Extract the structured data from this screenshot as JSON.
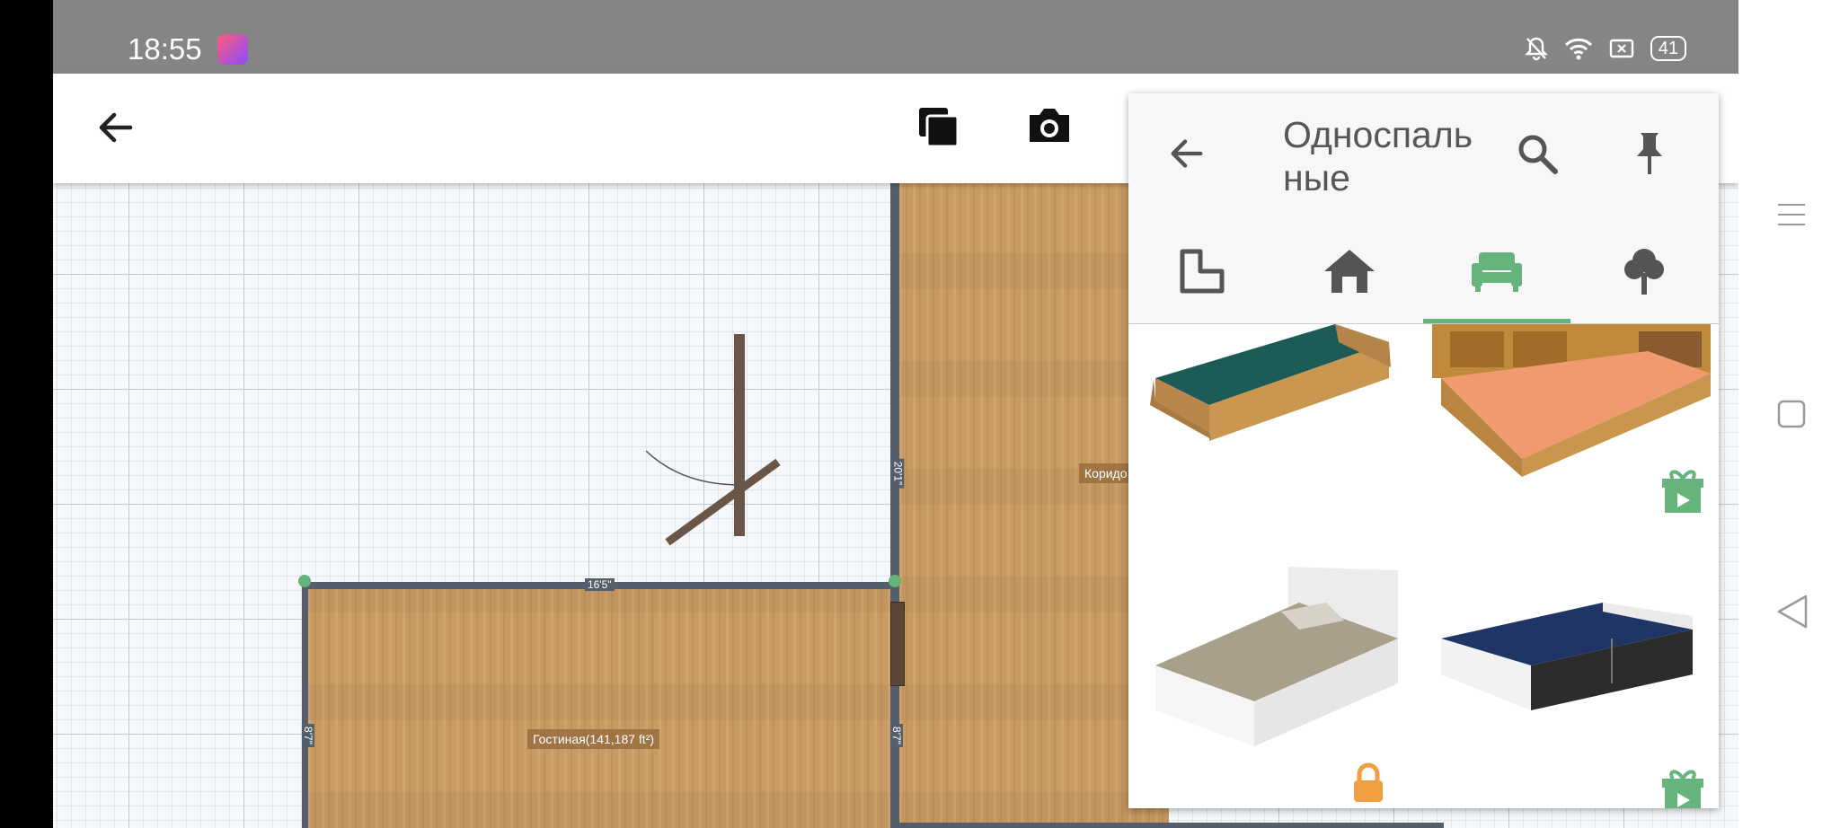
{
  "status_bar": {
    "time": "18:55",
    "battery": "41",
    "icons": [
      "mute-bell-icon",
      "wifi-icon",
      "sim-icon",
      "battery-icon"
    ]
  },
  "toolbar": {
    "icons": [
      "back-arrow-icon",
      "copy-icon",
      "camera-icon"
    ]
  },
  "plan": {
    "rooms": [
      {
        "name": "living-room",
        "label": "Гостиная(141,187 ft²)"
      },
      {
        "name": "corridor",
        "label": "Коридо"
      }
    ],
    "dimensions": {
      "living_top": "16'5\"",
      "living_left": "8'7\"",
      "living_right": "8'7\"",
      "corridor_left": "20'1\""
    }
  },
  "panel": {
    "title": "Односпальные",
    "tabs": [
      {
        "name": "tab-rooms",
        "icon": "room-shape-icon",
        "active": false
      },
      {
        "name": "tab-house",
        "icon": "house-icon",
        "active": false
      },
      {
        "name": "tab-furniture",
        "icon": "sofa-icon",
        "active": true
      },
      {
        "name": "tab-outdoor",
        "icon": "tree-icon",
        "active": false
      }
    ],
    "items": [
      {
        "name": "bed-oak-green",
        "badge": "none"
      },
      {
        "name": "bed-oak-shelf",
        "badge": "gift-video"
      },
      {
        "name": "bed-white-beige",
        "badge": "lock"
      },
      {
        "name": "bed-white-navy",
        "badge": "gift-video"
      }
    ]
  },
  "colors": {
    "accent": "#64b47c",
    "lock": "#f0a040",
    "status_bar": "#858585",
    "wall": "#555f6b"
  }
}
